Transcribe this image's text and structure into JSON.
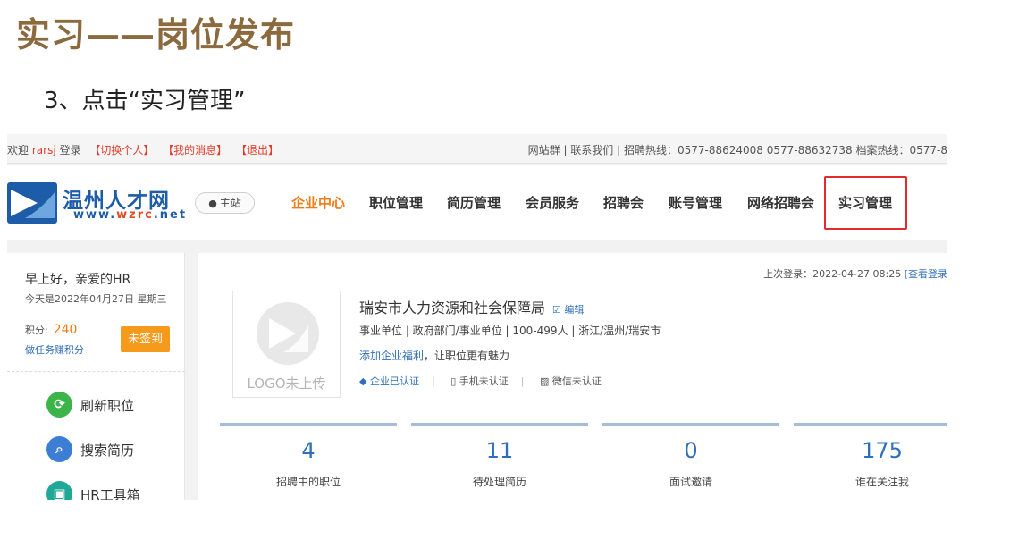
{
  "slide": {
    "title": "实习——岗位发布",
    "step": "3、点击“实习管理”"
  },
  "topbar": {
    "welcome": "欢迎",
    "username": "rarsj",
    "login_text": "登录",
    "switch_personal": "【切换个人】",
    "my_messages": "【我的消息】",
    "logout": "【退出】",
    "right_text": "网站群 | 联系我们 | 招聘热线：0577-88624008 0577-88632738 档案热线：0577-8"
  },
  "header": {
    "logo_cn": "温州人才网",
    "logo_en_prefix": "www.",
    "logo_en_hl": "wzrc",
    "logo_en_suffix": ".net",
    "site_button": "主站",
    "nav": [
      {
        "label": "企业中心",
        "active": true
      },
      {
        "label": "职位管理"
      },
      {
        "label": "简历管理"
      },
      {
        "label": "会员服务"
      },
      {
        "label": "招聘会"
      },
      {
        "label": "账号管理"
      },
      {
        "label": "网络招聘会"
      },
      {
        "label": "实习管理",
        "highlighted": true
      }
    ],
    "highlight_color": "#e32b2b",
    "active_color": "#f27b11"
  },
  "sidebar": {
    "greeting": "早上好，亲爱的HR",
    "date": "今天是2022年04月27日   星期三",
    "points_label": "积分:",
    "points_value": "240",
    "task_link": "做任务赚积分",
    "sign_button": "未签到",
    "items": [
      {
        "label": "刷新职位",
        "icon": "refresh-icon",
        "color": "#3bb54a"
      },
      {
        "label": "搜索简历",
        "icon": "search-icon",
        "color": "#3b7ed4"
      },
      {
        "label": "HR工具箱",
        "icon": "toolbox-icon",
        "color": "#1fa896"
      }
    ]
  },
  "main": {
    "last_login": "上次登录：2022-04-27 08:25",
    "view_login": "[查看登录",
    "logo_placeholder": "LOGO未上传",
    "company_name": "瑞安市人力资源和社会保障局",
    "edit_link": "编辑",
    "meta": "事业单位 | 政府部门/事业单位 | 100-499人 | 浙江/温州/瑞安市",
    "welfare_link": "添加企业福利",
    "welfare_text": "，让职位更有魅力",
    "certs": {
      "company": "企业已认证",
      "phone": "手机未认证",
      "wechat": "微信未认证"
    },
    "stats": [
      {
        "value": "4",
        "label": "招聘中的职位"
      },
      {
        "value": "11",
        "label": "待处理简历"
      },
      {
        "value": "0",
        "label": "面试邀请"
      },
      {
        "value": "175",
        "label": "谁在关注我"
      }
    ]
  }
}
